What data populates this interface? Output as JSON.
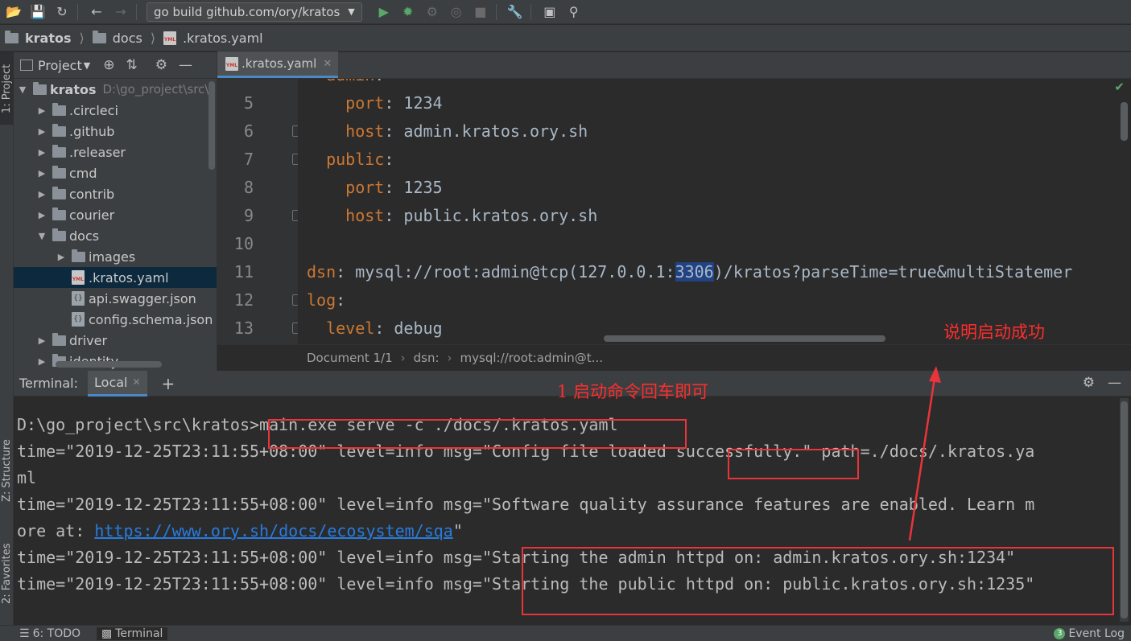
{
  "toolbar": {
    "run_config": "go build github.com/ory/kratos",
    "icons": [
      "folder-open-icon",
      "save-icon",
      "sync-icon",
      "back-icon",
      "forward-icon",
      "run-icon",
      "debug-icon",
      "coverage-icon",
      "profile-icon",
      "stop-icon",
      "wrench-icon",
      "terminal-window-icon",
      "search-icon"
    ]
  },
  "breadcrumb": [
    "kratos",
    "docs",
    ".kratos.yaml"
  ],
  "left_strip": {
    "project_tab": "1: Project",
    "structure_tab": "Z: Structure",
    "favorites_tab": "2: Favorites"
  },
  "project": {
    "title": "Project",
    "root": {
      "name": "kratos",
      "path": "D:\\go_project\\src\\"
    },
    "items": [
      {
        "name": ".circleci",
        "type": "folder",
        "depth": 1,
        "expanded": false
      },
      {
        "name": ".github",
        "type": "folder",
        "depth": 1,
        "expanded": false
      },
      {
        "name": ".releaser",
        "type": "folder",
        "depth": 1,
        "expanded": false
      },
      {
        "name": "cmd",
        "type": "folder",
        "depth": 1,
        "expanded": false
      },
      {
        "name": "contrib",
        "type": "folder",
        "depth": 1,
        "expanded": false
      },
      {
        "name": "courier",
        "type": "folder",
        "depth": 1,
        "expanded": false
      },
      {
        "name": "docs",
        "type": "folder",
        "depth": 1,
        "expanded": true
      },
      {
        "name": "images",
        "type": "folder",
        "depth": 2,
        "expanded": false
      },
      {
        "name": ".kratos.yaml",
        "type": "yaml",
        "depth": 2,
        "selected": true
      },
      {
        "name": "api.swagger.json",
        "type": "json",
        "depth": 2
      },
      {
        "name": "config.schema.json",
        "type": "json",
        "depth": 2
      },
      {
        "name": "driver",
        "type": "folder",
        "depth": 1,
        "expanded": false
      },
      {
        "name": "identity",
        "type": "folder",
        "depth": 1,
        "expanded": false
      }
    ]
  },
  "editor": {
    "tab": ".kratos.yaml",
    "lines": [
      {
        "n": "5",
        "indent": "    ",
        "key": "port",
        "val": " 1234"
      },
      {
        "n": "6",
        "indent": "    ",
        "key": "host",
        "val": " admin.kratos.ory.sh"
      },
      {
        "n": "7",
        "indent": "  ",
        "key": "public",
        "val": ""
      },
      {
        "n": "8",
        "indent": "    ",
        "key": "port",
        "val": " 1235"
      },
      {
        "n": "9",
        "indent": "    ",
        "key": "host",
        "val": " public.kratos.ory.sh"
      },
      {
        "n": "10",
        "indent": "",
        "key": "",
        "val": ""
      },
      {
        "n": "11",
        "indent": "",
        "key": "dsn",
        "val": " mysql://root:admin@tcp(127.0.0.1:",
        "hl": "3306",
        "rest": ")/kratos?parseTime=true&multiStatemer"
      },
      {
        "n": "12",
        "indent": "",
        "key": "log",
        "val": ""
      },
      {
        "n": "13",
        "indent": "  ",
        "key": "level",
        "val": " debug"
      }
    ],
    "status_breadcrumb": [
      "Document 1/1",
      "dsn:",
      "mysql://root:admin@t..."
    ]
  },
  "terminal": {
    "label": "Terminal:",
    "tab": "Local",
    "lines": [
      {
        "text": ""
      },
      {
        "text": "D:\\go_project\\src\\kratos>main.exe serve -c ./docs/.kratos.yaml"
      },
      {
        "text": "time=\"2019-12-25T23:11:55+08:00\" level=info msg=\"Config file loaded successfully.\" path=./docs/.kratos.ya"
      },
      {
        "text": "ml"
      },
      {
        "text": "time=\"2019-12-25T23:11:55+08:00\" level=info msg=\"Software quality assurance features are enabled. Learn m"
      },
      {
        "text": "ore at: ",
        "link": "https://www.ory.sh/docs/ecosystem/sqa",
        "after": "\""
      },
      {
        "text": "time=\"2019-12-25T23:11:55+08:00\" level=info msg=\"Starting the admin httpd on: admin.kratos.ory.sh:1234\""
      },
      {
        "text": "time=\"2019-12-25T23:11:55+08:00\" level=info msg=\"Starting the public httpd on: public.kratos.ory.sh:1235\""
      }
    ]
  },
  "annotations": {
    "step1": "1 启动命令回车即可",
    "success": "说明启动成功"
  },
  "statusbar": {
    "todo": "6: TODO",
    "terminal": "Terminal",
    "event_log": "Event Log",
    "event_count": "3"
  },
  "colors": {
    "annotation": "#e8343a",
    "keyword": "#cc7832",
    "link": "#287bde",
    "selection": "#214283"
  }
}
